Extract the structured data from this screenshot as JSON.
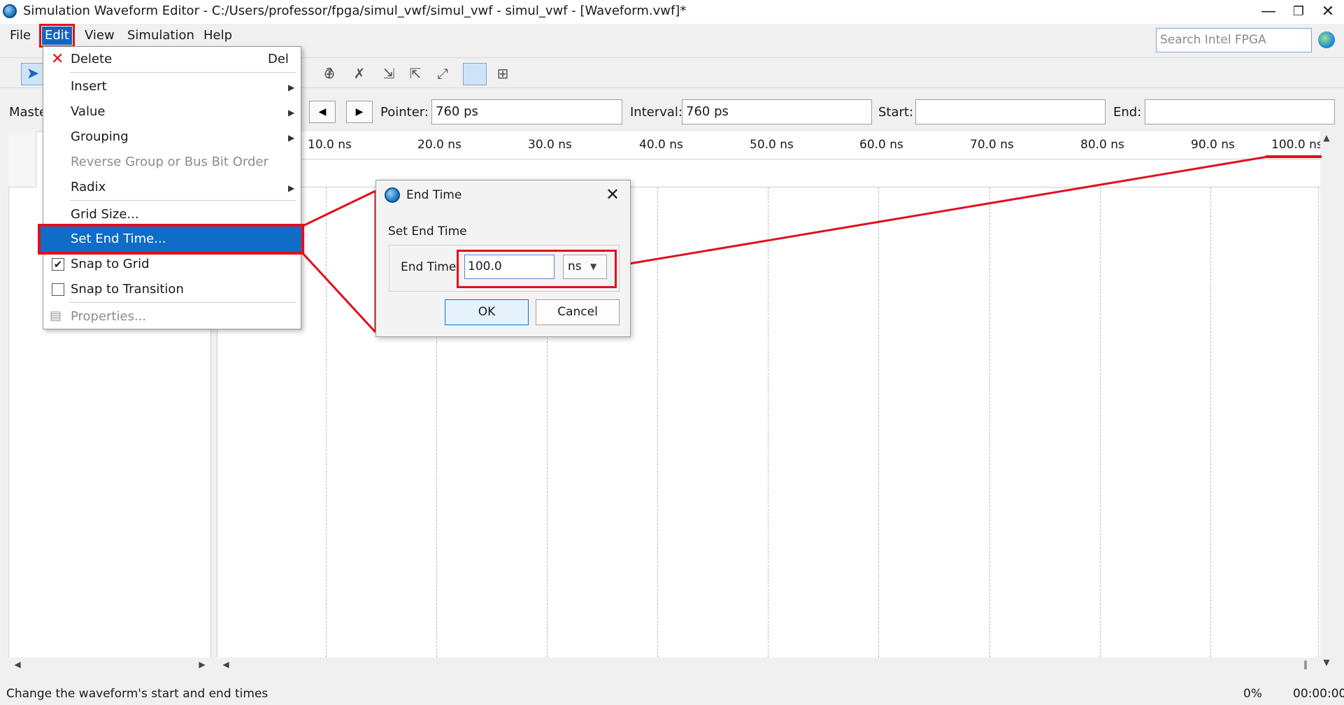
{
  "window": {
    "title": "Simulation Waveform Editor - C:/Users/professor/fpga/simul_vwf/simul_vwf - simul_vwf - [Waveform.vwf]*",
    "minimize_glyph": "—",
    "restore_glyph": "❐",
    "close_glyph": "✕"
  },
  "menubar": {
    "items": [
      "File",
      "Edit",
      "View",
      "Simulation",
      "Help"
    ]
  },
  "search": {
    "placeholder": "Search Intel FPGA"
  },
  "navrow": {
    "master_label": "Maste",
    "prev_glyph": "◀",
    "next_glyph": "▶",
    "pointer_label": "Pointer:",
    "pointer_value": "760 ps",
    "interval_label": "Interval:",
    "interval_value": "760 ps",
    "start_label": "Start:",
    "start_value": "",
    "end_label": "End:",
    "end_value": ""
  },
  "timeline": {
    "ticks": [
      "10.0 ns",
      "20.0 ns",
      "30.0 ns",
      "40.0 ns",
      "50.0 ns",
      "60.0 ns",
      "70.0 ns",
      "80.0 ns",
      "90.0 ns",
      "100.0 ns"
    ]
  },
  "edit_menu": {
    "delete_label": "Delete",
    "delete_shortcut": "Del",
    "insert_label": "Insert",
    "value_label": "Value",
    "grouping_label": "Grouping",
    "reverse_label": "Reverse Group or Bus Bit Order",
    "radix_label": "Radix",
    "grid_size_label": "Grid Size...",
    "set_end_time_label": "Set End Time...",
    "snap_grid_label": "Snap to Grid",
    "snap_grid_checked": true,
    "snap_transition_label": "Snap to Transition",
    "snap_transition_checked": false,
    "properties_label": "Properties..."
  },
  "dialog": {
    "title": "End Time",
    "group_title": "Set End Time",
    "field_label": "End Time:",
    "field_value": "100.0",
    "unit": "ns",
    "ok_label": "OK",
    "cancel_label": "Cancel"
  },
  "statusbar": {
    "message": "Change the waveform's start and end times",
    "progress": "0%",
    "elapsed": "00:00:00"
  },
  "colors": {
    "highlight_red": "#e0101e",
    "selection_blue": "#0f6cc7"
  }
}
